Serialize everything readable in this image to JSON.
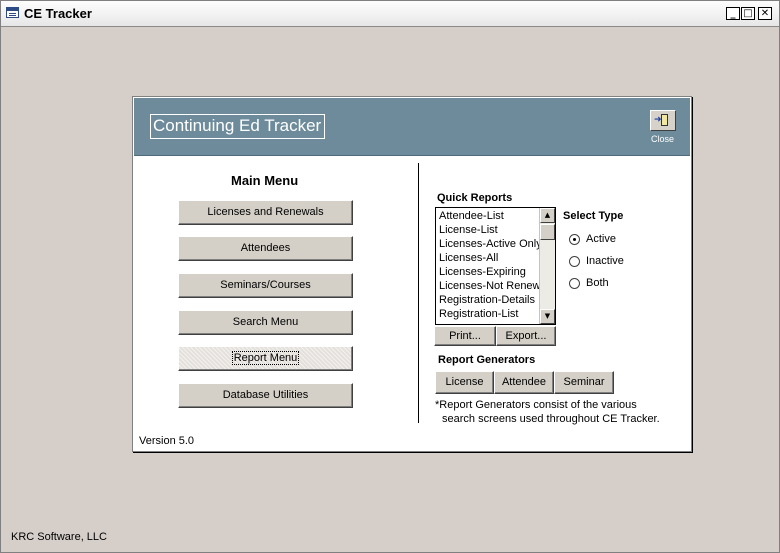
{
  "window": {
    "title": "CE Tracker",
    "controls": {
      "minimize": "_",
      "maximize": "□",
      "close": "✕"
    },
    "status_text": "KRC Software, LLC"
  },
  "header": {
    "title": "Continuing Ed Tracker",
    "close_label": "Close"
  },
  "main_menu": {
    "title": "Main Menu",
    "buttons": [
      "Licenses and Renewals",
      "Attendees",
      "Seminars/Courses",
      "Search Menu",
      "Report Menu",
      "Database Utilities"
    ]
  },
  "version": "Version 5.0",
  "quick_reports": {
    "title": "Quick Reports",
    "items": [
      "Attendee-List",
      "License-List",
      "Licenses-Active Only",
      "Licenses-All",
      "Licenses-Expiring",
      "Licenses-Not Renewed",
      "Registration-Details",
      "Registration-List"
    ],
    "print_label": "Print...",
    "export_label": "Export..."
  },
  "select_type": {
    "title": "Select Type",
    "options": [
      "Active",
      "Inactive",
      "Both"
    ],
    "selected": "Active"
  },
  "report_generators": {
    "title": "Report Generators",
    "buttons": [
      "License",
      "Attendee",
      "Seminar"
    ],
    "note_line1": "*Report Generators consist of  the various",
    "note_line2": "search screens used throughout CE Tracker."
  }
}
